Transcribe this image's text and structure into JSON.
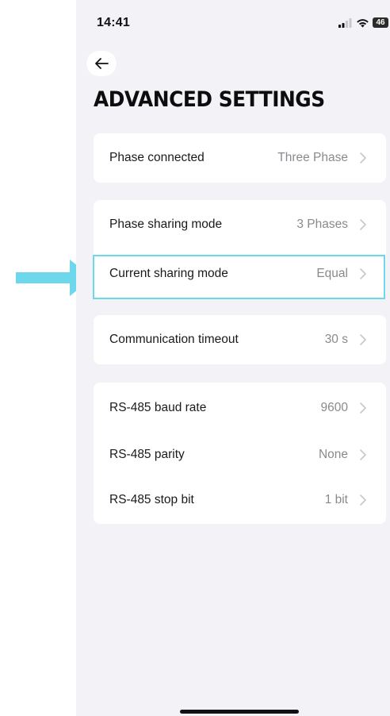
{
  "status_bar": {
    "time": "14:41",
    "battery": "46"
  },
  "header": {
    "title": "ADVANCED SETTINGS",
    "back_icon": "arrow-left-icon"
  },
  "groups": [
    {
      "items": [
        {
          "label": "Phase connected",
          "value": "Three Phase"
        }
      ]
    },
    {
      "items": [
        {
          "label": "Phase sharing mode",
          "value": "3 Phases"
        },
        {
          "label": "Current sharing mode",
          "value": "Equal"
        }
      ]
    },
    {
      "items": [
        {
          "label": "Communication timeout",
          "value": "30 s"
        }
      ]
    },
    {
      "items": [
        {
          "label": "RS-485 baud rate",
          "value": "9600"
        },
        {
          "label": "RS-485 parity",
          "value": "None"
        },
        {
          "label": "RS-485 stop bit",
          "value": "1 bit"
        }
      ]
    }
  ],
  "annotation": {
    "highlight_color": "#6dd8ec",
    "arrow_color": "#6dd8ec"
  }
}
